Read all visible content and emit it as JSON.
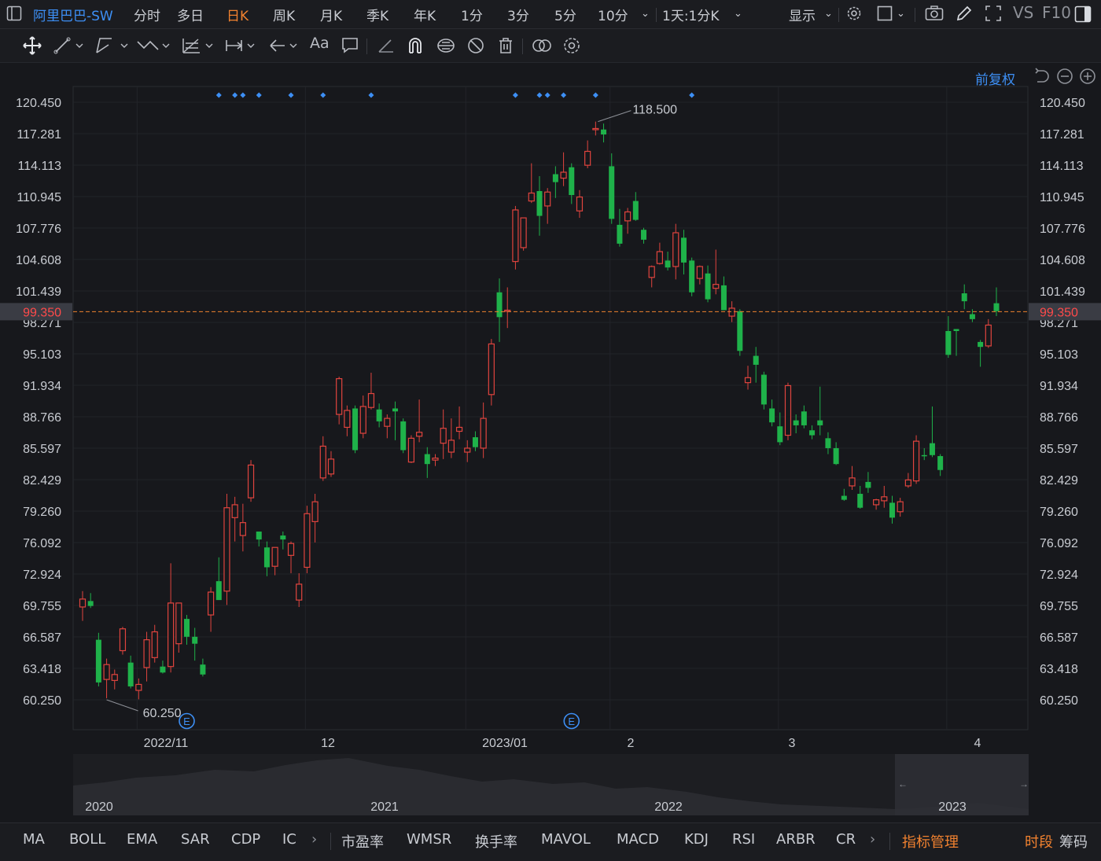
{
  "header": {
    "title": "阿里巴巴-SW",
    "periods": [
      "分时",
      "多日",
      "日K",
      "周K",
      "月K",
      "季K",
      "年K",
      "1分",
      "3分",
      "5分",
      "10分"
    ],
    "active_period": "日K",
    "combo": "1天:1分K",
    "display_label": "显示",
    "vs_label": "VS",
    "f10_label": "F10"
  },
  "toolbar": {
    "text_tool": "Aa"
  },
  "chart_meta": {
    "adjust_label": "前复权",
    "current_price_label": "99.350",
    "high_label": "118.500",
    "low_label": "60.250",
    "earnings_marker": "E"
  },
  "colors": {
    "up": "#e0443e",
    "down": "#1fb24a",
    "accent": "#f0812f",
    "link": "#3d8ff5",
    "marker": "#3d8ff5"
  },
  "chart_data": {
    "type": "candlestick",
    "y_ticks": [
      "120.450",
      "117.281",
      "114.113",
      "110.945",
      "107.776",
      "104.608",
      "101.439",
      "98.271",
      "95.103",
      "91.934",
      "88.766",
      "85.597",
      "82.429",
      "79.260",
      "76.092",
      "72.924",
      "69.755",
      "66.587",
      "63.418",
      "60.250"
    ],
    "ylim": [
      60.25,
      120.45
    ],
    "x_labels": [
      "2022/11",
      "12",
      "2023/01",
      "2",
      "3",
      "4"
    ],
    "current_price": 99.35,
    "high": 118.5,
    "low": 60.25,
    "candles": [
      {
        "o": 69.6,
        "h": 71.2,
        "l": 68.2,
        "c": 70.4
      },
      {
        "o": 70.2,
        "h": 71.0,
        "l": 69.5,
        "c": 69.7
      },
      {
        "o": 66.3,
        "h": 67.0,
        "l": 61.6,
        "c": 62.0
      },
      {
        "o": 62.3,
        "h": 64.4,
        "l": 60.4,
        "c": 63.8
      },
      {
        "o": 62.2,
        "h": 63.3,
        "l": 61.3,
        "c": 62.8
      },
      {
        "o": 65.2,
        "h": 67.6,
        "l": 64.8,
        "c": 67.4
      },
      {
        "o": 64.0,
        "h": 64.7,
        "l": 61.4,
        "c": 61.6
      },
      {
        "o": 61.2,
        "h": 62.4,
        "l": 60.3,
        "c": 61.8
      },
      {
        "o": 63.5,
        "h": 67.1,
        "l": 62.1,
        "c": 66.3
      },
      {
        "o": 64.5,
        "h": 67.8,
        "l": 64.0,
        "c": 67.1
      },
      {
        "o": 63.6,
        "h": 64.2,
        "l": 62.9,
        "c": 63.0
      },
      {
        "o": 63.6,
        "h": 74.0,
        "l": 63.0,
        "c": 70.0
      },
      {
        "o": 65.9,
        "h": 70.0,
        "l": 65.0,
        "c": 70.0
      },
      {
        "o": 68.4,
        "h": 68.8,
        "l": 65.8,
        "c": 66.6
      },
      {
        "o": 66.6,
        "h": 67.5,
        "l": 64.2,
        "c": 65.9
      },
      {
        "o": 63.8,
        "h": 64.4,
        "l": 62.6,
        "c": 62.8
      },
      {
        "o": 68.8,
        "h": 71.6,
        "l": 67.1,
        "c": 71.1
      },
      {
        "o": 72.2,
        "h": 74.6,
        "l": 71.0,
        "c": 70.3
      },
      {
        "o": 71.2,
        "h": 81.0,
        "l": 69.8,
        "c": 79.6
      },
      {
        "o": 78.6,
        "h": 80.7,
        "l": 76.2,
        "c": 79.9
      },
      {
        "o": 76.8,
        "h": 80.0,
        "l": 75.2,
        "c": 78.1
      },
      {
        "o": 80.6,
        "h": 84.4,
        "l": 80.2,
        "c": 83.9
      },
      {
        "o": 77.2,
        "h": 76.8,
        "l": 75.7,
        "c": 76.4
      },
      {
        "o": 75.6,
        "h": 76.2,
        "l": 72.7,
        "c": 73.6
      },
      {
        "o": 73.7,
        "h": 75.6,
        "l": 72.8,
        "c": 75.6
      },
      {
        "o": 76.8,
        "h": 77.2,
        "l": 75.4,
        "c": 76.4
      },
      {
        "o": 74.8,
        "h": 76.2,
        "l": 73.0,
        "c": 76.0
      },
      {
        "o": 70.3,
        "h": 73.0,
        "l": 69.6,
        "c": 71.9
      },
      {
        "o": 73.6,
        "h": 79.8,
        "l": 73.0,
        "c": 79.0
      },
      {
        "o": 78.2,
        "h": 81.0,
        "l": 76.1,
        "c": 80.2
      },
      {
        "o": 82.6,
        "h": 86.8,
        "l": 82.3,
        "c": 85.8
      },
      {
        "o": 83.0,
        "h": 85.3,
        "l": 82.7,
        "c": 84.5
      },
      {
        "o": 89.0,
        "h": 92.8,
        "l": 88.0,
        "c": 92.6
      },
      {
        "o": 87.7,
        "h": 89.9,
        "l": 86.8,
        "c": 89.4
      },
      {
        "o": 89.6,
        "h": 89.9,
        "l": 85.1,
        "c": 85.4
      },
      {
        "o": 87.1,
        "h": 90.9,
        "l": 86.6,
        "c": 89.8
      },
      {
        "o": 89.7,
        "h": 93.2,
        "l": 89.5,
        "c": 91.1
      },
      {
        "o": 89.5,
        "h": 90.1,
        "l": 87.7,
        "c": 88.3
      },
      {
        "o": 87.8,
        "h": 89.0,
        "l": 86.6,
        "c": 88.6
      },
      {
        "o": 89.6,
        "h": 90.3,
        "l": 86.4,
        "c": 89.3
      },
      {
        "o": 88.3,
        "h": 88.6,
        "l": 85.1,
        "c": 85.4
      },
      {
        "o": 84.2,
        "h": 86.9,
        "l": 84.1,
        "c": 86.6
      },
      {
        "o": 86.8,
        "h": 90.5,
        "l": 86.2,
        "c": 87.2
      },
      {
        "o": 85.0,
        "h": 85.7,
        "l": 82.6,
        "c": 84.0
      },
      {
        "o": 84.4,
        "h": 85.0,
        "l": 83.8,
        "c": 84.6
      },
      {
        "o": 86.1,
        "h": 89.5,
        "l": 84.5,
        "c": 87.6
      },
      {
        "o": 85.2,
        "h": 88.6,
        "l": 84.6,
        "c": 86.4
      },
      {
        "o": 87.3,
        "h": 89.8,
        "l": 86.5,
        "c": 87.7
      },
      {
        "o": 85.2,
        "h": 86.4,
        "l": 84.2,
        "c": 85.6
      },
      {
        "o": 86.7,
        "h": 87.3,
        "l": 85.3,
        "c": 85.7
      },
      {
        "o": 85.6,
        "h": 90.2,
        "l": 84.6,
        "c": 88.6
      },
      {
        "o": 91.0,
        "h": 96.6,
        "l": 89.9,
        "c": 96.1
      },
      {
        "o": 101.3,
        "h": 102.7,
        "l": 96.3,
        "c": 98.8
      },
      {
        "o": 99.4,
        "h": 101.8,
        "l": 97.7,
        "c": 99.5
      },
      {
        "o": 104.4,
        "h": 110.0,
        "l": 103.6,
        "c": 109.6
      },
      {
        "o": 105.8,
        "h": 108.8,
        "l": 105.5,
        "c": 108.8
      },
      {
        "o": 110.5,
        "h": 114.3,
        "l": 110.3,
        "c": 111.3
      },
      {
        "o": 111.5,
        "h": 113.0,
        "l": 107.0,
        "c": 109.0
      },
      {
        "o": 110.0,
        "h": 111.8,
        "l": 108.2,
        "c": 111.4
      },
      {
        "o": 113.2,
        "h": 114.0,
        "l": 110.8,
        "c": 112.4
      },
      {
        "o": 112.8,
        "h": 115.4,
        "l": 112.0,
        "c": 113.4
      },
      {
        "o": 113.9,
        "h": 114.3,
        "l": 110.2,
        "c": 111.1
      },
      {
        "o": 109.5,
        "h": 111.6,
        "l": 108.8,
        "c": 110.9
      },
      {
        "o": 114.1,
        "h": 116.6,
        "l": 113.8,
        "c": 115.5
      },
      {
        "o": 117.7,
        "h": 118.5,
        "l": 117.1,
        "c": 117.8
      },
      {
        "o": 117.7,
        "h": 118.3,
        "l": 116.4,
        "c": 117.2
      },
      {
        "o": 114.0,
        "h": 115.3,
        "l": 108.2,
        "c": 108.7
      },
      {
        "o": 108.1,
        "h": 109.7,
        "l": 105.9,
        "c": 106.2
      },
      {
        "o": 108.5,
        "h": 109.8,
        "l": 107.2,
        "c": 109.4
      },
      {
        "o": 110.5,
        "h": 111.4,
        "l": 108.5,
        "c": 108.6
      },
      {
        "o": 107.6,
        "h": 107.8,
        "l": 106.2,
        "c": 106.6
      },
      {
        "o": 102.8,
        "h": 104.0,
        "l": 101.8,
        "c": 103.9
      },
      {
        "o": 104.2,
        "h": 106.3,
        "l": 104.1,
        "c": 105.4
      },
      {
        "o": 104.5,
        "h": 105.4,
        "l": 103.5,
        "c": 103.8
      },
      {
        "o": 103.9,
        "h": 108.2,
        "l": 102.6,
        "c": 107.3
      },
      {
        "o": 106.8,
        "h": 107.6,
        "l": 103.1,
        "c": 104.3
      },
      {
        "o": 104.5,
        "h": 104.8,
        "l": 100.9,
        "c": 101.3
      },
      {
        "o": 102.7,
        "h": 104.0,
        "l": 102.1,
        "c": 103.9
      },
      {
        "o": 103.2,
        "h": 104.0,
        "l": 100.3,
        "c": 100.6
      },
      {
        "o": 101.7,
        "h": 105.6,
        "l": 101.1,
        "c": 102.1
      },
      {
        "o": 102.0,
        "h": 102.9,
        "l": 99.5,
        "c": 99.5
      },
      {
        "o": 98.9,
        "h": 100.4,
        "l": 98.3,
        "c": 99.7
      },
      {
        "o": 99.4,
        "h": 99.6,
        "l": 94.9,
        "c": 95.4
      },
      {
        "o": 92.2,
        "h": 93.9,
        "l": 91.5,
        "c": 92.7
      },
      {
        "o": 94.9,
        "h": 95.8,
        "l": 92.2,
        "c": 94.0
      },
      {
        "o": 93.0,
        "h": 93.3,
        "l": 89.5,
        "c": 90.0
      },
      {
        "o": 89.6,
        "h": 90.5,
        "l": 87.8,
        "c": 88.2
      },
      {
        "o": 87.8,
        "h": 89.2,
        "l": 85.9,
        "c": 86.2
      },
      {
        "o": 86.9,
        "h": 92.2,
        "l": 86.4,
        "c": 91.9
      },
      {
        "o": 88.4,
        "h": 89.0,
        "l": 87.1,
        "c": 87.9
      },
      {
        "o": 89.3,
        "h": 89.9,
        "l": 87.6,
        "c": 87.9
      },
      {
        "o": 87.4,
        "h": 87.9,
        "l": 86.5,
        "c": 86.9
      },
      {
        "o": 88.4,
        "h": 91.8,
        "l": 86.9,
        "c": 87.9
      },
      {
        "o": 86.6,
        "h": 87.2,
        "l": 85.0,
        "c": 85.6
      },
      {
        "o": 85.6,
        "h": 86.2,
        "l": 83.9,
        "c": 84.0
      },
      {
        "o": 80.8,
        "h": 81.5,
        "l": 80.3,
        "c": 80.4
      },
      {
        "o": 81.8,
        "h": 83.8,
        "l": 81.4,
        "c": 82.6
      },
      {
        "o": 81.0,
        "h": 81.8,
        "l": 79.5,
        "c": 79.6
      },
      {
        "o": 82.2,
        "h": 83.2,
        "l": 81.1,
        "c": 81.6
      },
      {
        "o": 79.9,
        "h": 80.5,
        "l": 79.4,
        "c": 80.4
      },
      {
        "o": 80.3,
        "h": 81.8,
        "l": 79.6,
        "c": 80.7
      },
      {
        "o": 80.1,
        "h": 80.8,
        "l": 78.0,
        "c": 78.6
      },
      {
        "o": 79.2,
        "h": 80.6,
        "l": 78.7,
        "c": 80.2
      },
      {
        "o": 81.8,
        "h": 83.1,
        "l": 81.6,
        "c": 82.4
      },
      {
        "o": 82.3,
        "h": 86.9,
        "l": 82.0,
        "c": 86.3
      },
      {
        "o": 84.9,
        "h": 85.6,
        "l": 84.4,
        "c": 84.8
      },
      {
        "o": 86.1,
        "h": 89.8,
        "l": 84.7,
        "c": 84.9
      },
      {
        "o": 84.8,
        "h": 85.0,
        "l": 82.8,
        "c": 83.4
      },
      {
        "o": 97.4,
        "h": 98.9,
        "l": 94.7,
        "c": 95.0
      },
      {
        "o": 97.6,
        "h": 97.6,
        "l": 94.9,
        "c": 97.4
      },
      {
        "o": 101.2,
        "h": 102.1,
        "l": 99.6,
        "c": 100.4
      },
      {
        "o": 99.1,
        "h": 99.6,
        "l": 98.3,
        "c": 98.6
      },
      {
        "o": 96.3,
        "h": 96.5,
        "l": 93.8,
        "c": 95.8
      },
      {
        "o": 95.9,
        "h": 98.6,
        "l": 95.7,
        "c": 98.0
      },
      {
        "o": 100.2,
        "h": 101.8,
        "l": 98.9,
        "c": 99.4
      }
    ],
    "event_markers_top": [
      17,
      19,
      20,
      22,
      26,
      30,
      36,
      54,
      57,
      58,
      60,
      64,
      76
    ],
    "earnings_markers": [
      13,
      61
    ],
    "overview_labels": [
      "2020",
      "2021",
      "2022",
      "2023"
    ]
  },
  "bottom": {
    "indicators": [
      "MA",
      "BOLL",
      "EMA",
      "SAR",
      "CDP",
      "IC"
    ],
    "indicators2": [
      "市盈率",
      "WMSR",
      "换手率",
      "MAVOL",
      "MACD",
      "KDJ",
      "RSI",
      "ARBR",
      "CR"
    ],
    "manage": "指标管理",
    "period_label": "时段",
    "chips_label": "筹码"
  }
}
